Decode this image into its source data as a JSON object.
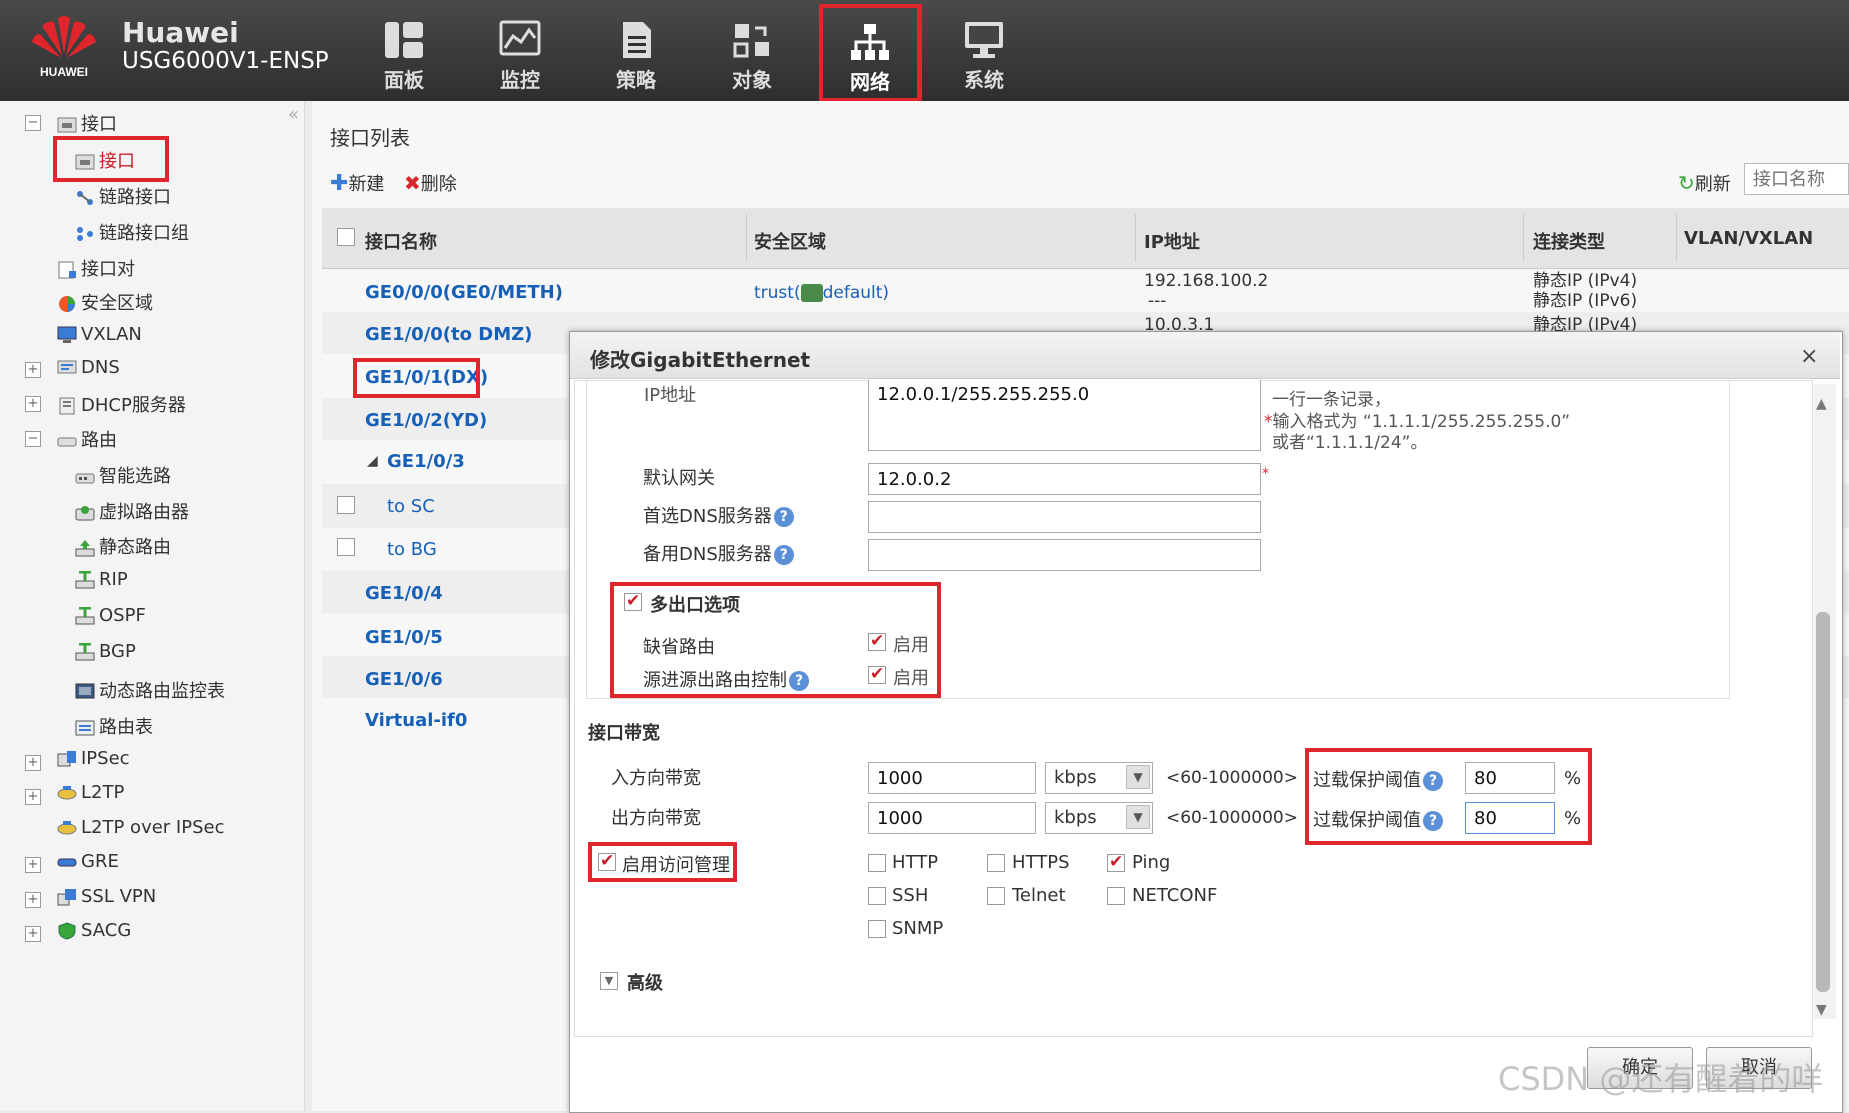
{
  "brand": {
    "name": "Huawei",
    "model": "USG6000V1-ENSP",
    "logo_text": "HUAWEI"
  },
  "nav": [
    {
      "label": "面板",
      "icon": "dashboard-icon"
    },
    {
      "label": "监控",
      "icon": "monitor-icon"
    },
    {
      "label": "策略",
      "icon": "policy-icon"
    },
    {
      "label": "对象",
      "icon": "object-icon"
    },
    {
      "label": "网络",
      "icon": "network-icon",
      "active": true
    },
    {
      "label": "系统",
      "icon": "system-icon"
    }
  ],
  "sidebar": {
    "items": [
      {
        "label": "接口"
      },
      {
        "label": "接口"
      },
      {
        "label": "链路接口"
      },
      {
        "label": "链路接口组"
      },
      {
        "label": "接口对"
      },
      {
        "label": "安全区域"
      },
      {
        "label": "VXLAN"
      },
      {
        "label": "DNS"
      },
      {
        "label": "DHCP服务器"
      },
      {
        "label": "路由"
      },
      {
        "label": "智能选路"
      },
      {
        "label": "虚拟路由器"
      },
      {
        "label": "静态路由"
      },
      {
        "label": "RIP"
      },
      {
        "label": "OSPF"
      },
      {
        "label": "BGP"
      },
      {
        "label": "动态路由监控表"
      },
      {
        "label": "路由表"
      },
      {
        "label": "IPSec"
      },
      {
        "label": "L2TP"
      },
      {
        "label": "L2TP over IPSec"
      },
      {
        "label": "GRE"
      },
      {
        "label": "SSL VPN"
      },
      {
        "label": "SACG"
      }
    ],
    "collapse_glyph": "«"
  },
  "list": {
    "title": "接口列表",
    "new_label": "新建",
    "delete_label": "删除",
    "refresh_label": "刷新",
    "search_placeholder": "接口名称",
    "columns": [
      "接口名称",
      "安全区域",
      "IP地址",
      "连接类型",
      "VLAN/VXLAN"
    ],
    "rows": [
      {
        "name": "GE0/0/0(GE0/METH)",
        "zone_prefix": "trust(",
        "zone_suffix": "default)",
        "ip": "192.168.100.2",
        "ip2": "---",
        "type": "静态IP (IPv4)",
        "type2": "静态IP (IPv6)"
      },
      {
        "name": "GE1/0/0(to DMZ)",
        "ip": "10.0.3.1",
        "type": "静态IP (IPv4)"
      },
      {
        "name": "GE1/0/1(DX)"
      },
      {
        "name": "GE1/0/2(YD)"
      },
      {
        "name": "GE1/0/3"
      },
      {
        "name": "to  SC"
      },
      {
        "name": "to  BG"
      },
      {
        "name": "GE1/0/4"
      },
      {
        "name": "GE1/0/5"
      },
      {
        "name": "GE1/0/6"
      },
      {
        "name": "Virtual-if0"
      }
    ]
  },
  "dialog": {
    "title": "修改GigabitEthernet",
    "close_glyph": "×",
    "ip_label": "IP地址",
    "ip_value": "12.0.0.1/255.255.255.0",
    "ip_hint1": "一行一条记录，",
    "ip_hint2": "输入格式为 “1.1.1.1/255.255.255.0”",
    "ip_hint3": "或者“1.1.1.1/24”。",
    "gateway_label": "默认网关",
    "gateway_value": "12.0.0.2",
    "dns1_label": "首选DNS服务器",
    "dns2_label": "备用DNS服务器",
    "multi_exit_label": "多出口选项",
    "default_route_label": "缺省路由",
    "source_route_label": "源进源出路由控制",
    "enable_label": "启用",
    "bandwidth_title": "接口带宽",
    "in_bw_label": "入方向带宽",
    "out_bw_label": "出方向带宽",
    "in_bw_value": "1000",
    "out_bw_value": "1000",
    "unit": "kbps",
    "range": "<60-1000000>",
    "overload_label": "过载保护阈值",
    "overload_in": "80",
    "overload_out": "80",
    "percent": "%",
    "access_mgmt_label": "启用访问管理",
    "protocols": [
      "HTTP",
      "HTTPS",
      "Ping",
      "SSH",
      "Telnet",
      "NETCONF",
      "SNMP"
    ],
    "advanced_label": "高级",
    "ok_label": "确定",
    "cancel_label": "取消"
  },
  "watermark": "CSDN @还有醒着的咩"
}
